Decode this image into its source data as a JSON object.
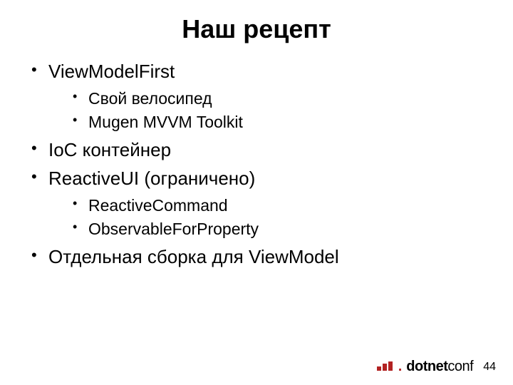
{
  "title": "Наш рецепт",
  "bullets": [
    {
      "text": "ViewModelFirst",
      "children": [
        "Свой велосипед",
        "Mugen MVVM Toolkit"
      ]
    },
    {
      "text": "IoC контейнер",
      "children": []
    },
    {
      "text": "ReactiveUI (ограничено)",
      "children": [
        "ReactiveCommand",
        "ObservableForProperty"
      ]
    },
    {
      "text": "Отдельная сборка для ViewModel",
      "children": []
    }
  ],
  "footer": {
    "page": "44",
    "brand_dot": ".",
    "brand_name": "dotnet",
    "brand_suffix": "conf"
  }
}
